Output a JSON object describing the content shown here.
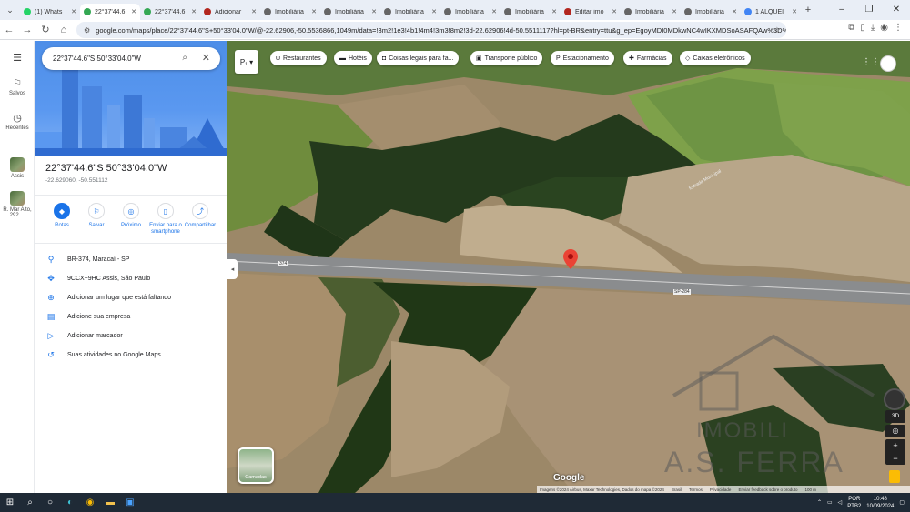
{
  "browser": {
    "tabs": [
      {
        "label": "(1) Whats",
        "color": "#25d366",
        "icon": "whatsapp-icon"
      },
      {
        "label": "22°37'44.6",
        "color": "#34a853",
        "icon": "maps-icon",
        "active": true
      },
      {
        "label": "22°37'44.6",
        "color": "#34a853",
        "icon": "maps-icon"
      },
      {
        "label": "Adicionar",
        "color": "#b3261e",
        "icon": "k-icon"
      },
      {
        "label": "Imobiliária",
        "color": "#666666",
        "icon": "house-icon"
      },
      {
        "label": "Imobiliária",
        "color": "#666666",
        "icon": "house-icon"
      },
      {
        "label": "Imobiliária",
        "color": "#666666",
        "icon": "house-icon"
      },
      {
        "label": "Imobiliária",
        "color": "#666666",
        "icon": "house-icon"
      },
      {
        "label": "Imobiliária",
        "color": "#666666",
        "icon": "house-icon"
      },
      {
        "label": "Editar imó",
        "color": "#b3261e",
        "icon": "k-icon"
      },
      {
        "label": "Imobiliária",
        "color": "#666666",
        "icon": "house-icon"
      },
      {
        "label": "Imobiliária",
        "color": "#666666",
        "icon": "house-icon"
      },
      {
        "label": "1 ALQUEI",
        "color": "#4285f4",
        "icon": "google-icon"
      }
    ],
    "url": "google.com/maps/place/22°37'44.6\"S+50°33'04.0\"W/@-22.62906,-50.5536866,1049m/data=!3m2!1e3!4b1!4m4!3m3!8m2!3d-22.62906!4d-50.5511117?hl=pt-BR&entry=ttu&g_ep=EgoyMDI0MDkwNC4wIKXMDSoASAFQAw%3D%3D"
  },
  "rail": {
    "menu_icon": "menu-icon",
    "saved_label": "Salvos",
    "recent_label": "Recentes",
    "recent1_label": "Assis",
    "recent2_label": "R. Mar Alto, 292 ..."
  },
  "search": {
    "value": "22°37'44.6\"S 50°33'04.0\"W"
  },
  "place": {
    "title": "22°37'44.6\"S 50°33'04.0\"W",
    "coords": "-22.629060, -50.551112"
  },
  "actions": [
    {
      "label": "Rotas",
      "icon": "directions-icon"
    },
    {
      "label": "Salvar",
      "icon": "bookmark-icon"
    },
    {
      "label": "Próximo",
      "icon": "nearby-icon"
    },
    {
      "label": "Enviar para o smartphone",
      "icon": "phone-icon"
    },
    {
      "label": "Compartilhar",
      "icon": "share-icon"
    }
  ],
  "info": [
    {
      "label": "BR-374, Maracaí - SP",
      "icon": "pin-icon"
    },
    {
      "label": "9CCX+9HC Assis, São Paulo",
      "icon": "plus-code-icon"
    },
    {
      "label": "Adicionar um lugar que está faltando",
      "icon": "add-place-icon"
    },
    {
      "label": "Adicione sua empresa",
      "icon": "business-icon"
    },
    {
      "label": "Adicionar marcador",
      "icon": "label-icon"
    },
    {
      "label": "Suas atividades no Google Maps",
      "icon": "history-icon"
    }
  ],
  "chips": [
    {
      "label": "Restaurantes",
      "icon": "restaurant-icon"
    },
    {
      "label": "Hotéis",
      "icon": "hotel-icon"
    },
    {
      "label": "Coisas legais para fa...",
      "icon": "camera-icon"
    },
    {
      "label": "Transporte público",
      "icon": "transit-icon"
    },
    {
      "label": "Estacionamento",
      "icon": "parking-icon"
    },
    {
      "label": "Farmácias",
      "icon": "pharmacy-icon"
    },
    {
      "label": "Caixas eletrônicos",
      "icon": "atm-icon"
    }
  ],
  "map": {
    "layers_label": "Camadas",
    "google_logo": "Google",
    "road_label_1": "374",
    "road_label_2": "SP-284",
    "road_label_3": "Estrada Municipal",
    "zoom_3d": "3D",
    "attribution": "Imagens ©2024 Airbus, Maxar Technologies, Dados do mapa ©2024",
    "brasil": "Brasil",
    "termos": "Termos",
    "privacidade": "Privacidade",
    "feedback": "Enviar feedback sobre o produto",
    "scale": "100 m",
    "watermark_line1": "IMOBILI",
    "watermark_line2": "A.S. FERRA"
  },
  "taskbar": {
    "lang": "POR",
    "layout": "PTB2",
    "time": "10:48",
    "date": "10/09/2024"
  }
}
